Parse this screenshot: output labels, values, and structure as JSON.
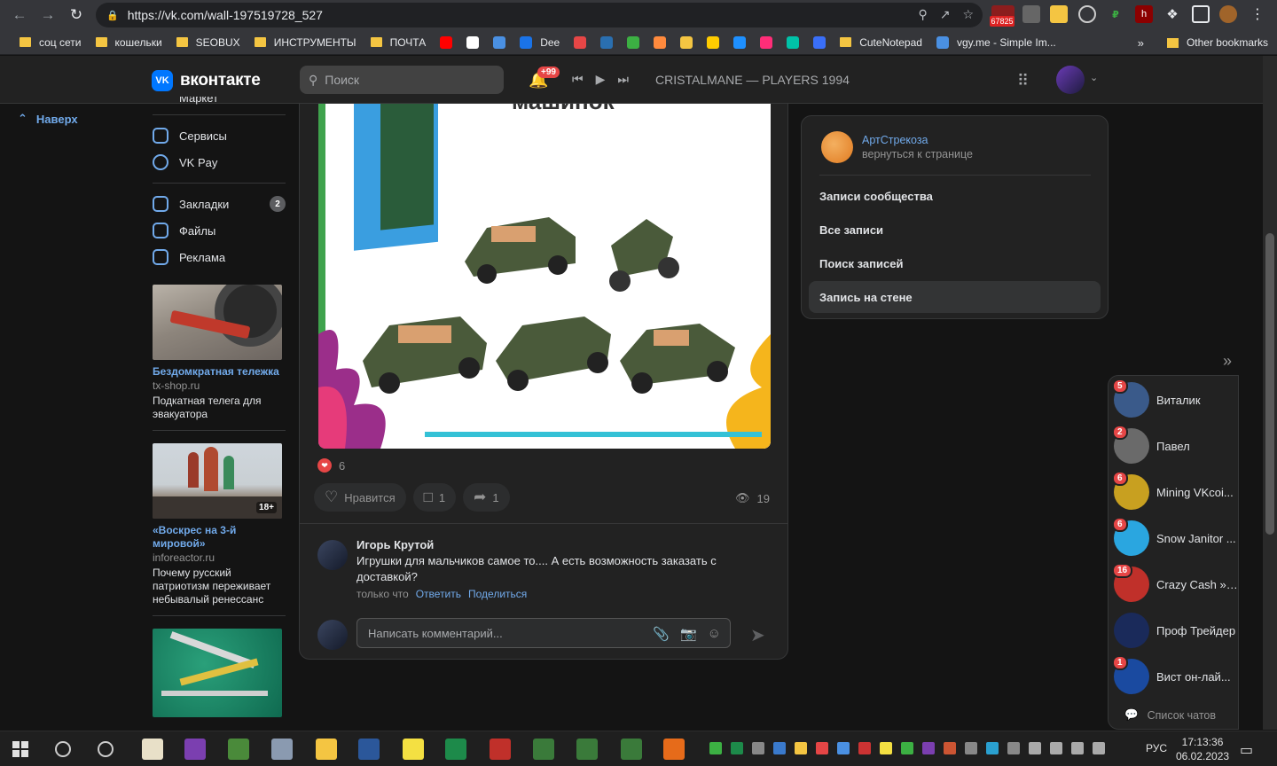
{
  "browser": {
    "url": "https://vk.com/wall-197519728_527",
    "ext_badge": "67825",
    "bookmarks": [
      {
        "label": "соц сети",
        "kind": "folder"
      },
      {
        "label": "кошельки",
        "kind": "folder"
      },
      {
        "label": "SEOBUX",
        "kind": "folder"
      },
      {
        "label": "ИНСТРУМЕНТЫ",
        "kind": "folder"
      },
      {
        "label": "ПОЧТА",
        "kind": "folder"
      },
      {
        "label": "",
        "kind": "icon",
        "color": "#ff0000"
      },
      {
        "label": "",
        "kind": "icon",
        "color": "#ffffff"
      },
      {
        "label": "",
        "kind": "icon",
        "color": "#4a90e2"
      },
      {
        "label": "Dee",
        "kind": "icon",
        "color": "#1a73e8"
      },
      {
        "label": "",
        "kind": "icon",
        "color": "#e64646"
      },
      {
        "label": "",
        "kind": "icon",
        "color": "#2a6fb0"
      },
      {
        "label": "",
        "kind": "icon",
        "color": "#3cb043"
      },
      {
        "label": "",
        "kind": "icon",
        "color": "#ff8a3d"
      },
      {
        "label": "",
        "kind": "icon",
        "color": "#f4c542"
      },
      {
        "label": "",
        "kind": "icon",
        "color": "#ffcc00"
      },
      {
        "label": "",
        "kind": "icon",
        "color": "#1e90ff"
      },
      {
        "label": "",
        "kind": "icon",
        "color": "#ff2d78"
      },
      {
        "label": "",
        "kind": "icon",
        "color": "#00c2a8"
      },
      {
        "label": "",
        "kind": "icon",
        "color": "#3a6ff8"
      },
      {
        "label": "CuteNotepad",
        "kind": "folder"
      },
      {
        "label": "vgy.me - Simple Im...",
        "kind": "icon",
        "color": "#4a90e2"
      }
    ],
    "bookmarks_more": "»",
    "other_bookmarks": "Other bookmarks"
  },
  "vk": {
    "logo_text": "вконтакте",
    "search_placeholder": "Поиск",
    "notif_badge": "+99",
    "now_playing": "CRISTALMANE — PLAYERS 1994"
  },
  "back_link": "Наверх",
  "sidebar": {
    "top_cut": "Маркет",
    "items": [
      {
        "label": "Сервисы",
        "icon": "services-icon"
      },
      {
        "label": "VK Pay",
        "icon": "vkpay-icon"
      },
      {
        "label": "Закладки",
        "icon": "bookmark-icon",
        "counter": "2"
      },
      {
        "label": "Файлы",
        "icon": "file-icon"
      },
      {
        "label": "Реклама",
        "icon": "megaphone-icon"
      }
    ],
    "ads": [
      {
        "title": "Бездомкратная тележка",
        "domain": "tx-shop.ru",
        "snippet": "Подкатная телега для эвакуатора"
      },
      {
        "title": "«Воскрес на 3-й мировой»",
        "domain": "inforeactor.ru",
        "snippet": "Почему русский патриотизм переживает небывалый ренессанс",
        "age": "18+"
      },
      {
        "title": "",
        "domain": "",
        "snippet": ""
      }
    ]
  },
  "post": {
    "image_caption": "машинок",
    "likes_count": "6",
    "like_label": "Нравится",
    "comments_count": "1",
    "shares_count": "1",
    "views_count": "19",
    "comment": {
      "author": "Игорь Крутой",
      "text": "Игрушки для мальчиков самое то.... А есть возможность заказать с доставкой?",
      "time": "только что",
      "reply_label": "Ответить",
      "share_label": "Поделиться"
    },
    "reply_placeholder": "Написать комментарий..."
  },
  "right_nav": {
    "group_name": "АртСтрекоза",
    "group_back": "вернуться к странице",
    "items": [
      {
        "label": "Записи сообщества",
        "selected": false
      },
      {
        "label": "Все записи",
        "selected": false
      },
      {
        "label": "Поиск записей",
        "selected": false
      },
      {
        "label": "Запись на стене",
        "selected": true
      }
    ]
  },
  "chats": {
    "toggle": "»",
    "items": [
      {
        "name": "Виталик",
        "unread": "5",
        "color": "#3a5a8a"
      },
      {
        "name": "Павел",
        "unread": "2",
        "color": "#6a6a6a"
      },
      {
        "name": "Mining VKcoi...",
        "unread": "6",
        "color": "#c8a020"
      },
      {
        "name": "Snow Janitor ...",
        "unread": "6",
        "color": "#2aa6e0"
      },
      {
        "name": "Crazy Cash » ...",
        "unread": "16",
        "color": "#c0302a"
      },
      {
        "name": "Проф Трейдер",
        "unread": "",
        "color": "#1a2a5a"
      },
      {
        "name": "Вист он-лай...",
        "unread": "1",
        "color": "#1a4aa0"
      }
    ],
    "search_label": "Список чатов"
  },
  "taskbar": {
    "lang": "РУС",
    "time": "17:13:36",
    "date": "06.02.2023"
  }
}
